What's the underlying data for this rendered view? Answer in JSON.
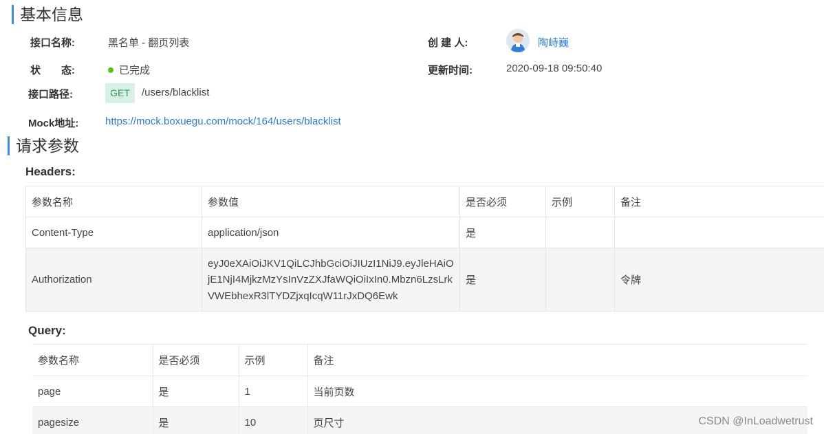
{
  "sections": {
    "basic_info": "基本信息",
    "request_params": "请求参数"
  },
  "info": {
    "name_label": "接口名称:",
    "name_value": "黑名单 - 翻页列表",
    "creator_label": "创 建 人:",
    "creator_name": "陶峙巍",
    "status_label": "状　　态:",
    "status_value": "已完成",
    "updated_label": "更新时间:",
    "updated_value": "2020-09-18 09:50:40",
    "path_label": "接口路径:",
    "method": "GET",
    "path_value": "/users/blacklist",
    "mock_label": "Mock地址:",
    "mock_url": "https://mock.boxuegu.com/mock/164/users/blacklist",
    "status_color": "#52c41a"
  },
  "headers": {
    "title": "Headers:",
    "columns": [
      "参数名称",
      "参数值",
      "是否必须",
      "示例",
      "备注"
    ],
    "rows": [
      [
        "Content-Type",
        "application/json",
        "是",
        "",
        ""
      ],
      [
        "Authorization",
        "eyJ0eXAiOiJKV1QiLCJhbGciOiJIUzI1NiJ9.eyJleHAiOjE1NjI4MjkzMzYsInVzZXJfaWQiOiIxIn0.Mbzn6LzsLrkVWEbhexR3lTYDZjxqIcqW11rJxDQ6Ewk",
        "是",
        "",
        "令牌"
      ]
    ]
  },
  "query": {
    "title": "Query:",
    "columns": [
      "参数名称",
      "是否必须",
      "示例",
      "备注"
    ],
    "rows": [
      [
        "page",
        "是",
        "1",
        "当前页数"
      ],
      [
        "pagesize",
        "是",
        "10",
        "页尺寸"
      ]
    ]
  },
  "watermark": "CSDN @InLoadwetrust"
}
